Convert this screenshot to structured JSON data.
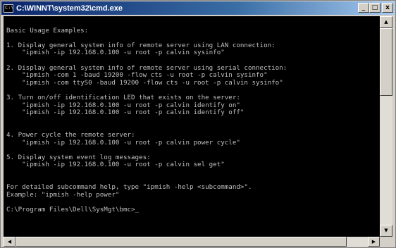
{
  "window": {
    "title": "C:\\WINNT\\system32\\cmd.exe",
    "icon_label": "C:\\",
    "minimize_symbol": "_",
    "maximize_symbol": "□",
    "close_symbol": "x"
  },
  "console": {
    "lines": [
      "",
      "Basic Usage Examples:",
      "",
      "1. Display general system info of remote server using LAN connection:",
      "    \"ipmish -ip 192.168.0.100 -u root -p calvin sysinfo\"",
      "",
      "2. Display general system info of remote server using serial connection:",
      "    \"ipmish -com 1 -baud 19200 -flow cts -u root -p calvin sysinfo\"",
      "    \"ipmish -com ttyS0 -baud 19200 -flow cts -u root -p calvin sysinfo\"",
      "",
      "3. Turn on/off identification LED that exists on the server:",
      "    \"ipmish -ip 192.168.0.100 -u root -p calvin identify on\"",
      "    \"ipmish -ip 192.168.0.100 -u root -p calvin identify off\"",
      "",
      "",
      "4. Power cycle the remote server:",
      "    \"ipmish -ip 192.168.0.100 -u root -p calvin power cycle\"",
      "",
      "5. Display system event log messages:",
      "    \"ipmish -ip 192.168.0.100 -u root -p calvin sel get\"",
      "",
      "",
      "For detailed subcommand help, type \"ipmish -help <subcommand>\".",
      "Example: \"ipmish -help power\"",
      "",
      "C:\\Program Files\\Dell\\SysMgt\\bmc>_"
    ]
  },
  "scrollbars": {
    "up_arrow": "▲",
    "down_arrow": "▼",
    "left_arrow": "◀",
    "right_arrow": "▶",
    "vertical_position": 0.0,
    "horizontal_position": 0.0
  },
  "colors": {
    "console_bg": "#000000",
    "console_fg": "#c0c0c0",
    "titlebar_start": "#0a246a",
    "titlebar_end": "#a6caf0"
  }
}
